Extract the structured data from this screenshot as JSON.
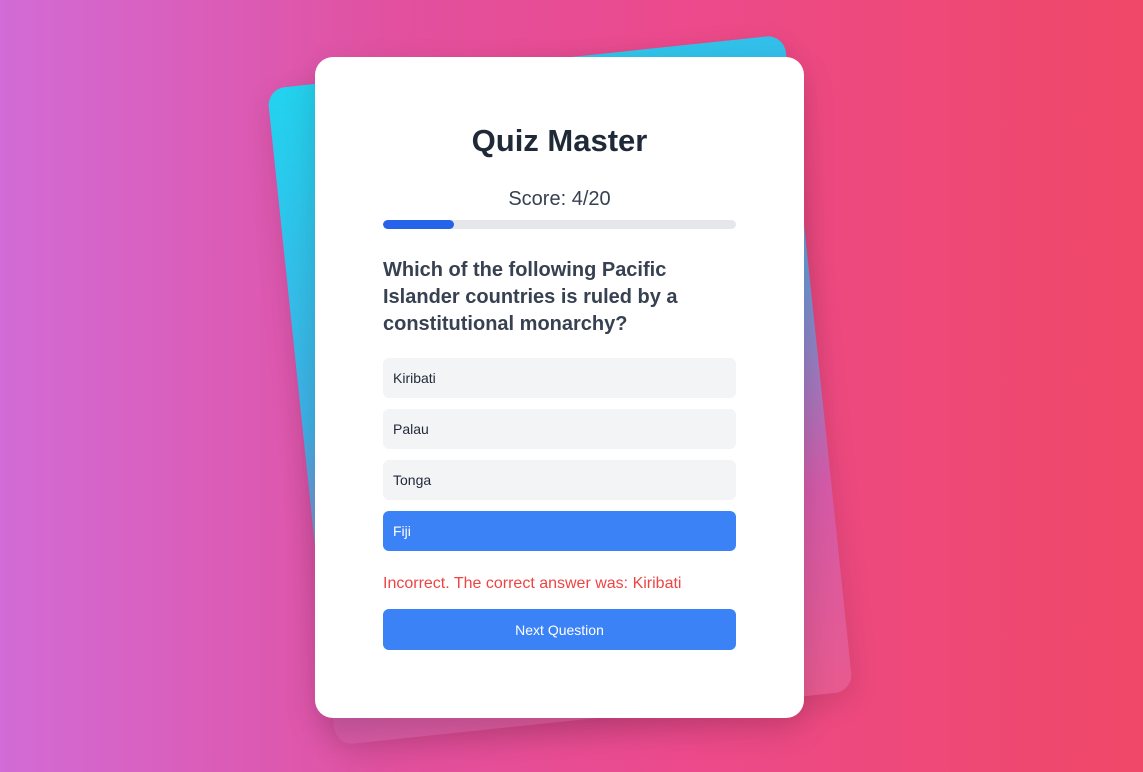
{
  "quiz": {
    "title": "Quiz Master",
    "score_text": "Score: 4/20",
    "progress_fraction": 0.2,
    "question": "Which of the following Pacific Islander countries is ruled by a constitutional monarchy?",
    "options": [
      {
        "label": "Kiribati",
        "selected": false
      },
      {
        "label": "Palau",
        "selected": false
      },
      {
        "label": "Tonga",
        "selected": false
      },
      {
        "label": "Fiji",
        "selected": true
      }
    ],
    "feedback": "Incorrect. The correct answer was: Kiribati",
    "next_label": "Next Question"
  },
  "colors": {
    "accent": "#3b82f6",
    "progress": "#2563eb",
    "error": "#ef4444",
    "option_bg": "#f3f4f6"
  }
}
